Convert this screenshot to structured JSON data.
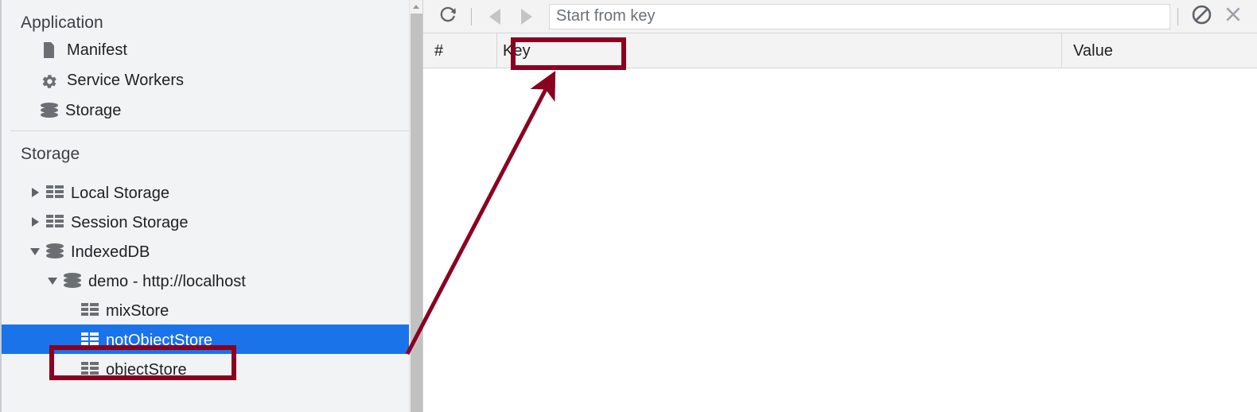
{
  "sidebar": {
    "application": {
      "title": "Application",
      "items": [
        {
          "label": "Manifest",
          "icon": "page-icon"
        },
        {
          "label": "Service Workers",
          "icon": "gear-icon"
        },
        {
          "label": "Storage",
          "icon": "database-icon"
        }
      ]
    },
    "storage": {
      "title": "Storage",
      "tree": [
        {
          "label": "Local Storage",
          "icon": "grid-icon",
          "twisty": "closed",
          "depth": 0,
          "selected": false
        },
        {
          "label": "Session Storage",
          "icon": "grid-icon",
          "twisty": "closed",
          "depth": 0,
          "selected": false
        },
        {
          "label": "IndexedDB",
          "icon": "database-icon",
          "twisty": "open",
          "depth": 0,
          "selected": false
        },
        {
          "label": "demo - http://localhost",
          "icon": "database-icon",
          "twisty": "open",
          "depth": 1,
          "selected": false
        },
        {
          "label": "mixStore",
          "icon": "grid-icon",
          "twisty": "none",
          "depth": 2,
          "selected": false
        },
        {
          "label": "notObjectStore",
          "icon": "grid-icon",
          "twisty": "none",
          "depth": 2,
          "selected": true
        },
        {
          "label": "objectStore",
          "icon": "grid-icon",
          "twisty": "none",
          "depth": 2,
          "selected": false
        }
      ]
    },
    "scrollbar": {
      "up_arrow_icon": "scroll-up-arrow-icon"
    }
  },
  "toolbar": {
    "refresh_icon": "refresh-icon",
    "prev_icon": "play-back-icon",
    "next_icon": "play-forward-icon",
    "clear_icon": "no-entry-clear-icon",
    "close_icon": "close-x-icon",
    "key_input": {
      "value": "",
      "placeholder": "Start from key"
    }
  },
  "grid": {
    "columns": [
      "#",
      "Key",
      "Value"
    ],
    "rows": []
  },
  "annotations": {
    "boxes": [
      {
        "target": "Key",
        "color": "#8b0020"
      },
      {
        "target": "notObjectStore",
        "color": "#8b0020"
      }
    ],
    "arrow": {
      "color": "#8b0020",
      "from": "notObjectStore",
      "to": "Key"
    }
  },
  "colors": {
    "selection_blue": "#1a73e8",
    "annotation_red": "#8b0020",
    "panel_bg": "#f1f3f4",
    "toolbar_bg": "#f3f3f3"
  }
}
